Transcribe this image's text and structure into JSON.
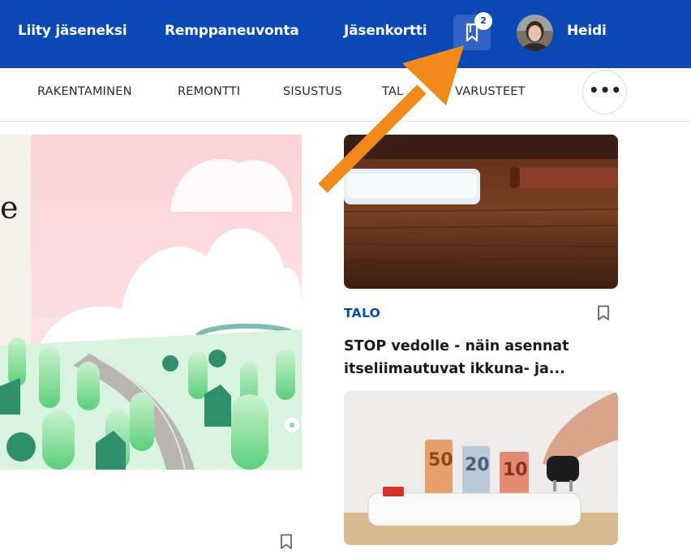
{
  "header": {
    "links": [
      "Liity jäseneksi",
      "Remppaneuvonta",
      "Jäsenkortti"
    ],
    "bookmark_count": "2",
    "user_name": "Heidi"
  },
  "subnav": {
    "items": [
      "RAKENTAMINEN",
      "REMONTTI",
      "SISUSTUS",
      "TAL",
      "VARUSTEET"
    ],
    "more_label": "•••"
  },
  "hero": {
    "partial_text": "e"
  },
  "article": {
    "category": "TALO",
    "title": "STOP vedolle - näin asennat itseliimautuvat ikkuna- ja..."
  },
  "colors": {
    "brand_blue": "#0a48b4",
    "arrow_orange": "#f28a1b"
  },
  "icons": {
    "bookmark": "bookmark-icon",
    "more": "more-icon"
  }
}
